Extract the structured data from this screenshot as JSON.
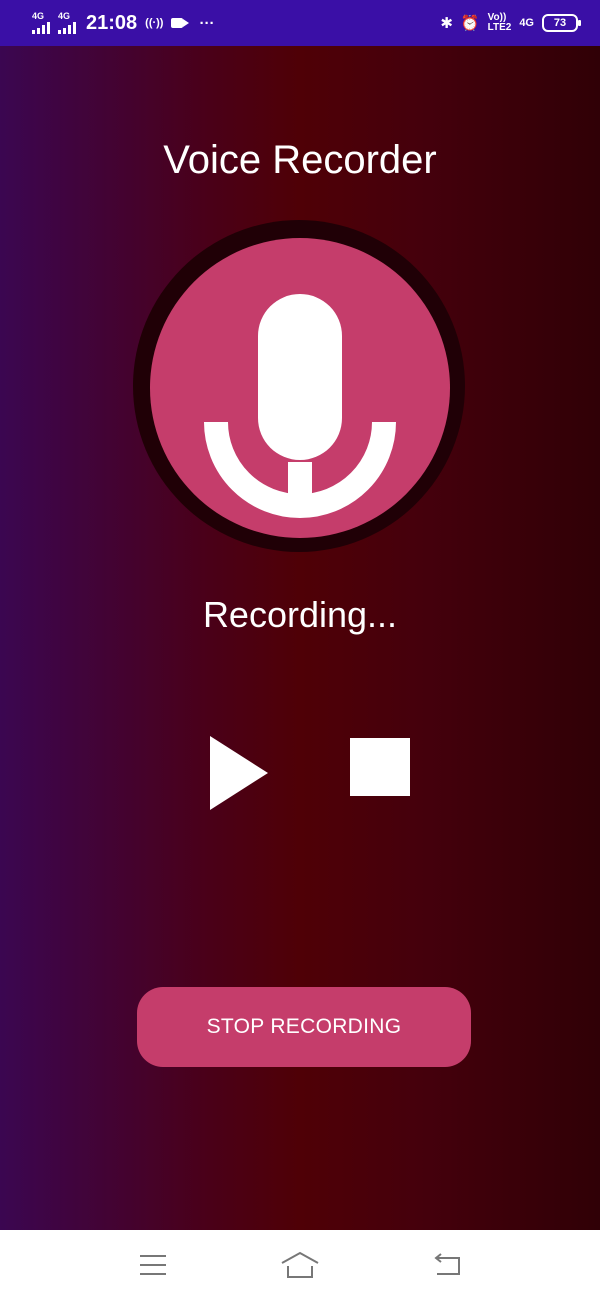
{
  "status_bar": {
    "sim1_tag": "4G",
    "sim2_tag": "4G",
    "time": "21:08",
    "hotspot_glyph": "((·))",
    "more_glyph": "···",
    "bluetooth_glyph": "✱",
    "alarm_glyph": "⏰",
    "volte_top": "Vo))",
    "volte_bottom": "LTE2",
    "network_type": "4G",
    "battery_level": "73"
  },
  "app": {
    "title": "Voice Recorder",
    "status_text": "Recording...",
    "main_button_label": "STOP RECORDING",
    "colors": {
      "accent": "#c53d6b",
      "ring": "#200006",
      "gradient_left": "#3b0651",
      "gradient_mid": "#4f0006",
      "gradient_right": "#300006"
    },
    "icons": {
      "mic": "microphone-icon",
      "play": "play-icon",
      "stop": "stop-icon"
    }
  },
  "nav_bar": {
    "icons": [
      "menu-icon",
      "home-icon",
      "back-icon"
    ]
  }
}
